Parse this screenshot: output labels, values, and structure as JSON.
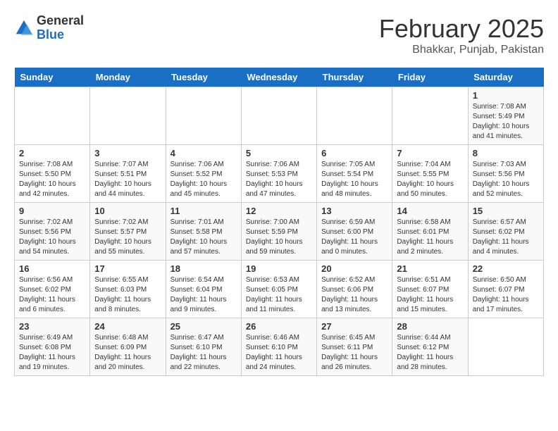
{
  "header": {
    "logo": {
      "general": "General",
      "blue": "Blue"
    },
    "title": "February 2025",
    "location": "Bhakkar, Punjab, Pakistan"
  },
  "weekdays": [
    "Sunday",
    "Monday",
    "Tuesday",
    "Wednesday",
    "Thursday",
    "Friday",
    "Saturday"
  ],
  "weeks": [
    [
      {
        "day": "",
        "info": ""
      },
      {
        "day": "",
        "info": ""
      },
      {
        "day": "",
        "info": ""
      },
      {
        "day": "",
        "info": ""
      },
      {
        "day": "",
        "info": ""
      },
      {
        "day": "",
        "info": ""
      },
      {
        "day": "1",
        "info": "Sunrise: 7:08 AM\nSunset: 5:49 PM\nDaylight: 10 hours\nand 41 minutes."
      }
    ],
    [
      {
        "day": "2",
        "info": "Sunrise: 7:08 AM\nSunset: 5:50 PM\nDaylight: 10 hours\nand 42 minutes."
      },
      {
        "day": "3",
        "info": "Sunrise: 7:07 AM\nSunset: 5:51 PM\nDaylight: 10 hours\nand 44 minutes."
      },
      {
        "day": "4",
        "info": "Sunrise: 7:06 AM\nSunset: 5:52 PM\nDaylight: 10 hours\nand 45 minutes."
      },
      {
        "day": "5",
        "info": "Sunrise: 7:06 AM\nSunset: 5:53 PM\nDaylight: 10 hours\nand 47 minutes."
      },
      {
        "day": "6",
        "info": "Sunrise: 7:05 AM\nSunset: 5:54 PM\nDaylight: 10 hours\nand 48 minutes."
      },
      {
        "day": "7",
        "info": "Sunrise: 7:04 AM\nSunset: 5:55 PM\nDaylight: 10 hours\nand 50 minutes."
      },
      {
        "day": "8",
        "info": "Sunrise: 7:03 AM\nSunset: 5:56 PM\nDaylight: 10 hours\nand 52 minutes."
      }
    ],
    [
      {
        "day": "9",
        "info": "Sunrise: 7:02 AM\nSunset: 5:56 PM\nDaylight: 10 hours\nand 54 minutes."
      },
      {
        "day": "10",
        "info": "Sunrise: 7:02 AM\nSunset: 5:57 PM\nDaylight: 10 hours\nand 55 minutes."
      },
      {
        "day": "11",
        "info": "Sunrise: 7:01 AM\nSunset: 5:58 PM\nDaylight: 10 hours\nand 57 minutes."
      },
      {
        "day": "12",
        "info": "Sunrise: 7:00 AM\nSunset: 5:59 PM\nDaylight: 10 hours\nand 59 minutes."
      },
      {
        "day": "13",
        "info": "Sunrise: 6:59 AM\nSunset: 6:00 PM\nDaylight: 11 hours\nand 0 minutes."
      },
      {
        "day": "14",
        "info": "Sunrise: 6:58 AM\nSunset: 6:01 PM\nDaylight: 11 hours\nand 2 minutes."
      },
      {
        "day": "15",
        "info": "Sunrise: 6:57 AM\nSunset: 6:02 PM\nDaylight: 11 hours\nand 4 minutes."
      }
    ],
    [
      {
        "day": "16",
        "info": "Sunrise: 6:56 AM\nSunset: 6:02 PM\nDaylight: 11 hours\nand 6 minutes."
      },
      {
        "day": "17",
        "info": "Sunrise: 6:55 AM\nSunset: 6:03 PM\nDaylight: 11 hours\nand 8 minutes."
      },
      {
        "day": "18",
        "info": "Sunrise: 6:54 AM\nSunset: 6:04 PM\nDaylight: 11 hours\nand 9 minutes."
      },
      {
        "day": "19",
        "info": "Sunrise: 6:53 AM\nSunset: 6:05 PM\nDaylight: 11 hours\nand 11 minutes."
      },
      {
        "day": "20",
        "info": "Sunrise: 6:52 AM\nSunset: 6:06 PM\nDaylight: 11 hours\nand 13 minutes."
      },
      {
        "day": "21",
        "info": "Sunrise: 6:51 AM\nSunset: 6:07 PM\nDaylight: 11 hours\nand 15 minutes."
      },
      {
        "day": "22",
        "info": "Sunrise: 6:50 AM\nSunset: 6:07 PM\nDaylight: 11 hours\nand 17 minutes."
      }
    ],
    [
      {
        "day": "23",
        "info": "Sunrise: 6:49 AM\nSunset: 6:08 PM\nDaylight: 11 hours\nand 19 minutes."
      },
      {
        "day": "24",
        "info": "Sunrise: 6:48 AM\nSunset: 6:09 PM\nDaylight: 11 hours\nand 20 minutes."
      },
      {
        "day": "25",
        "info": "Sunrise: 6:47 AM\nSunset: 6:10 PM\nDaylight: 11 hours\nand 22 minutes."
      },
      {
        "day": "26",
        "info": "Sunrise: 6:46 AM\nSunset: 6:10 PM\nDaylight: 11 hours\nand 24 minutes."
      },
      {
        "day": "27",
        "info": "Sunrise: 6:45 AM\nSunset: 6:11 PM\nDaylight: 11 hours\nand 26 minutes."
      },
      {
        "day": "28",
        "info": "Sunrise: 6:44 AM\nSunset: 6:12 PM\nDaylight: 11 hours\nand 28 minutes."
      },
      {
        "day": "",
        "info": ""
      }
    ]
  ]
}
